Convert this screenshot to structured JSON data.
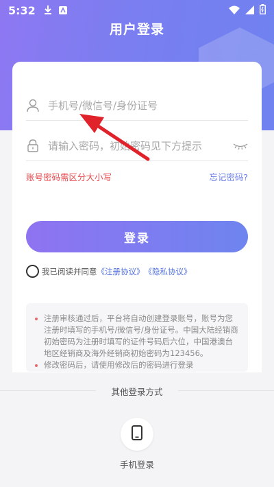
{
  "status_bar": {
    "time": "5:32"
  },
  "header": {
    "title": "用户登录"
  },
  "form": {
    "account_placeholder": "手机号/微信号/身份证号",
    "password_placeholder": "请输入密码，初始密码见下方提示",
    "case_hint": "账号密码需区分大小写",
    "forgot_label": "忘记密码?",
    "login_label": "登录",
    "agree_prefix": "我已阅读并同意",
    "register_agreement": "《注册协议》",
    "privacy_agreement": "《隐私协议》"
  },
  "notice": {
    "item1": "注册审核通过后，平台将自动创建登录账号，账号为您注册时填写的手机号/微信号/身份证号。中国大陆经销商初始密码为注册时填写的证件号码后六位，中国港澳台地区经销商及海外经销商初始密码为123456。",
    "item2": "修改密码后，请使用修改后的密码进行登录"
  },
  "other_login": {
    "title": "其他登录方式",
    "phone_login_label": "手机登录"
  },
  "colors": {
    "accent_start": "#8f73f0",
    "accent_end": "#6e84ef",
    "error": "#e5484d",
    "link": "#4f6fe0",
    "annotation_arrow": "#e0222a"
  }
}
